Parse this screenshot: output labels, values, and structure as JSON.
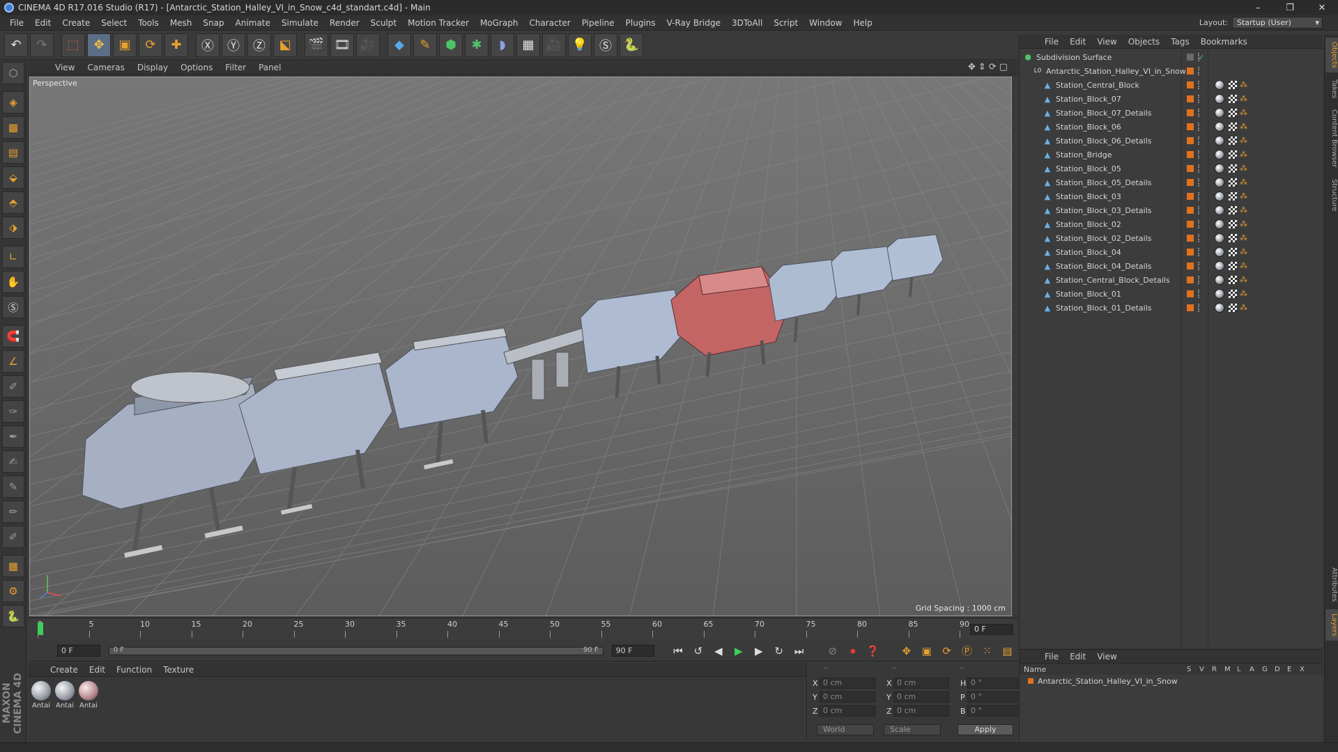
{
  "window": {
    "title": "CINEMA 4D R17.016 Studio (R17) - [Antarctic_Station_Halley_VI_in_Snow_c4d_standart.c4d] - Main",
    "controls": [
      "–",
      "❐",
      "✕"
    ]
  },
  "menu": [
    "File",
    "Edit",
    "Create",
    "Select",
    "Tools",
    "Mesh",
    "Snap",
    "Animate",
    "Simulate",
    "Render",
    "Sculpt",
    "Motion Tracker",
    "MoGraph",
    "Character",
    "Pipeline",
    "Plugins",
    "V-Ray Bridge",
    "3DToAll",
    "Script",
    "Window",
    "Help"
  ],
  "layout": {
    "label": "Layout:",
    "value": "Startup (User)"
  },
  "viewport": {
    "menu": [
      "View",
      "Cameras",
      "Display",
      "Options",
      "Filter",
      "Panel"
    ],
    "label": "Perspective",
    "grid_spacing": "Grid Spacing : 1000 cm",
    "nav_icons": "✥⇕⟳▢"
  },
  "timeline": {
    "ticks": [
      "0",
      "5",
      "10",
      "15",
      "20",
      "25",
      "30",
      "35",
      "40",
      "45",
      "50",
      "55",
      "60",
      "65",
      "70",
      "75",
      "80",
      "85",
      "90"
    ],
    "current_frame": "0 F"
  },
  "transport": {
    "start": "0 F",
    "range_start": "0 F",
    "range_end": "90 F",
    "end": "90 F"
  },
  "materials": {
    "menu": [
      "Create",
      "Edit",
      "Function",
      "Texture"
    ],
    "items": [
      {
        "label": "Antai",
        "tint": "grey"
      },
      {
        "label": "Antai",
        "tint": "grey"
      },
      {
        "label": "Antai",
        "tint": "red"
      }
    ]
  },
  "coordinates": {
    "header": [
      "--",
      "--",
      "--"
    ],
    "rows": [
      {
        "a": "X",
        "av": "0 cm",
        "b": "X",
        "bv": "0 cm",
        "c": "H",
        "cv": "0 °"
      },
      {
        "a": "Y",
        "av": "0 cm",
        "b": "Y",
        "bv": "0 cm",
        "c": "P",
        "cv": "0 °"
      },
      {
        "a": "Z",
        "av": "0 cm",
        "b": "Z",
        "bv": "0 cm",
        "c": "B",
        "cv": "0 °"
      }
    ],
    "mode": "World",
    "scale": "Scale",
    "apply": "Apply"
  },
  "objects": {
    "menu": [
      "File",
      "Edit",
      "View",
      "Objects",
      "Tags",
      "Bookmarks"
    ],
    "items": [
      {
        "name": "Subdivision Surface",
        "level": 0,
        "icon": "subdivision"
      },
      {
        "name": "Antarctic_Station_Halley_VI_in_Snow",
        "level": 1,
        "icon": "null"
      },
      {
        "name": "Station_Central_Block",
        "level": 2,
        "icon": "poly"
      },
      {
        "name": "Station_Block_07",
        "level": 2,
        "icon": "poly"
      },
      {
        "name": "Station_Block_07_Details",
        "level": 2,
        "icon": "poly"
      },
      {
        "name": "Station_Block_06",
        "level": 2,
        "icon": "poly"
      },
      {
        "name": "Station_Block_06_Details",
        "level": 2,
        "icon": "poly"
      },
      {
        "name": "Station_Bridge",
        "level": 2,
        "icon": "poly"
      },
      {
        "name": "Station_Block_05",
        "level": 2,
        "icon": "poly"
      },
      {
        "name": "Station_Block_05_Details",
        "level": 2,
        "icon": "poly"
      },
      {
        "name": "Station_Block_03",
        "level": 2,
        "icon": "poly"
      },
      {
        "name": "Station_Block_03_Details",
        "level": 2,
        "icon": "poly"
      },
      {
        "name": "Station_Block_02",
        "level": 2,
        "icon": "poly"
      },
      {
        "name": "Station_Block_02_Details",
        "level": 2,
        "icon": "poly"
      },
      {
        "name": "Station_Block_04",
        "level": 2,
        "icon": "poly"
      },
      {
        "name": "Station_Block_04_Details",
        "level": 2,
        "icon": "poly"
      },
      {
        "name": "Station_Central_Block_Details",
        "level": 2,
        "icon": "poly"
      },
      {
        "name": "Station_Block_01",
        "level": 2,
        "icon": "poly"
      },
      {
        "name": "Station_Block_01_Details",
        "level": 2,
        "icon": "poly"
      }
    ]
  },
  "layers": {
    "menu": [
      "File",
      "Edit",
      "View"
    ],
    "header_name": "Name",
    "columns": [
      "S",
      "V",
      "R",
      "M",
      "L",
      "A",
      "G",
      "D",
      "E",
      "X"
    ],
    "row": "Antarctic_Station_Halley_VI_in_Snow"
  },
  "side_tabs": [
    "Objects",
    "Takes",
    "Content Browser",
    "Structure",
    "Attributes",
    "Layers"
  ],
  "brand": "MAXON CINEMA 4D",
  "colors": {
    "accent": "#e0721e",
    "station_red": "#c46060",
    "station_blue": "#a8b8d0"
  }
}
